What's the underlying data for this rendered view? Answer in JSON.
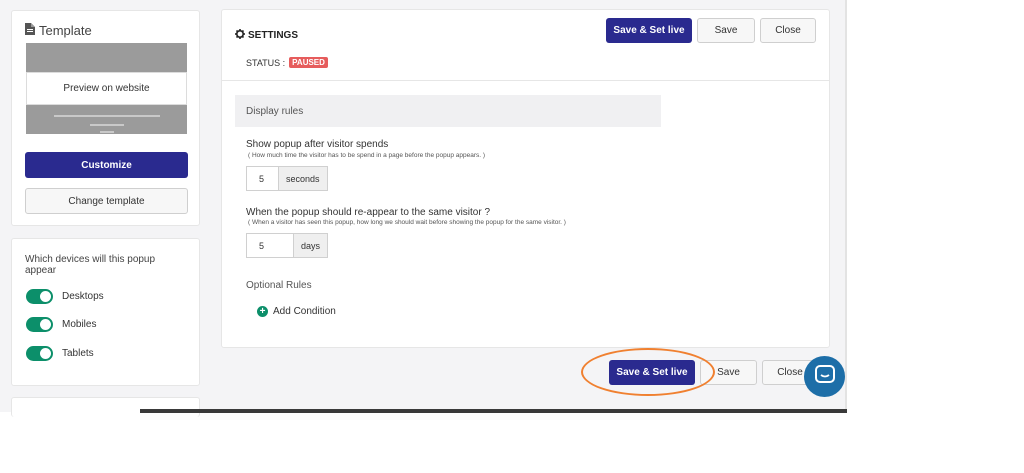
{
  "template": {
    "title": "Template",
    "preview_label": "Preview on website",
    "customize_label": "Customize",
    "change_template_label": "Change template"
  },
  "devices": {
    "question": "Which devices will this popup appear",
    "items": [
      {
        "label": "Desktops",
        "enabled": true
      },
      {
        "label": "Mobiles",
        "enabled": true
      },
      {
        "label": "Tablets",
        "enabled": true
      }
    ]
  },
  "settings": {
    "title": "SETTINGS",
    "status_label": "STATUS :",
    "status_value": "PAUSED",
    "save_live_label": "Save & Set live",
    "save_label": "Save",
    "close_label": "Close"
  },
  "display_rules": {
    "header": "Display rules",
    "q1": {
      "label": "Show popup after visitor spends",
      "hint": "( How much time the visitor has to be spend in a page before the popup appears. )",
      "value": "5",
      "unit": "seconds"
    },
    "q2": {
      "label": "When the popup should re-appear to the same visitor ?",
      "hint": "( When a visitor has seen this popup, how long we should wait before showing the popup for the same visitor. )",
      "value": "5",
      "unit": "days"
    },
    "optional_rules_label": "Optional Rules",
    "add_condition_label": "Add Condition"
  },
  "footer": {
    "save_live_label": "Save & Set live",
    "save_label": "Save",
    "close_label": "Close"
  },
  "colors": {
    "primary": "#2a2a8f",
    "toggle_on": "#0c8f6a",
    "status_paused": "#e65c5c",
    "highlight": "#f08030",
    "chat": "#1d6ea8"
  },
  "icons": {
    "template": "document-icon",
    "settings": "gear-icon",
    "add": "plus-circle-icon",
    "chat": "chat-icon"
  }
}
